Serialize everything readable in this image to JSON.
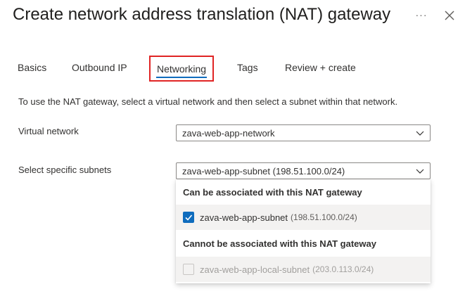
{
  "header": {
    "title": "Create network address translation (NAT) gateway",
    "more_icon": "ellipsis-icon",
    "more_label": "···",
    "close_icon": "close-icon"
  },
  "tabs": [
    {
      "label": "Basics",
      "active": false
    },
    {
      "label": "Outbound IP",
      "active": false
    },
    {
      "label": "Networking",
      "active": true
    },
    {
      "label": "Tags",
      "active": false
    },
    {
      "label": "Review + create",
      "active": false
    }
  ],
  "highlight_color": "#e02424",
  "accent_color": "#0f6cbd",
  "intro_text": "To use the NAT gateway, select a virtual network and then select a subnet within that network.",
  "form": {
    "virtual_network": {
      "label": "Virtual network",
      "value": "zava-web-app-network"
    },
    "subnets": {
      "label": "Select specific subnets",
      "value": "zava-web-app-subnet (198.51.100.0/24)",
      "expanded": true
    }
  },
  "dropdown": {
    "group_associable": "Can be associated with this NAT gateway",
    "group_not_associable": "Cannot be associated with this NAT gateway",
    "options": [
      {
        "name": "zava-web-app-subnet",
        "cidr": "(198.51.100.0/24)",
        "checked": true,
        "disabled": false
      },
      {
        "name": "zava-web-app-local-subnet",
        "cidr": "(203.0.113.0/24)",
        "checked": false,
        "disabled": true
      }
    ]
  }
}
